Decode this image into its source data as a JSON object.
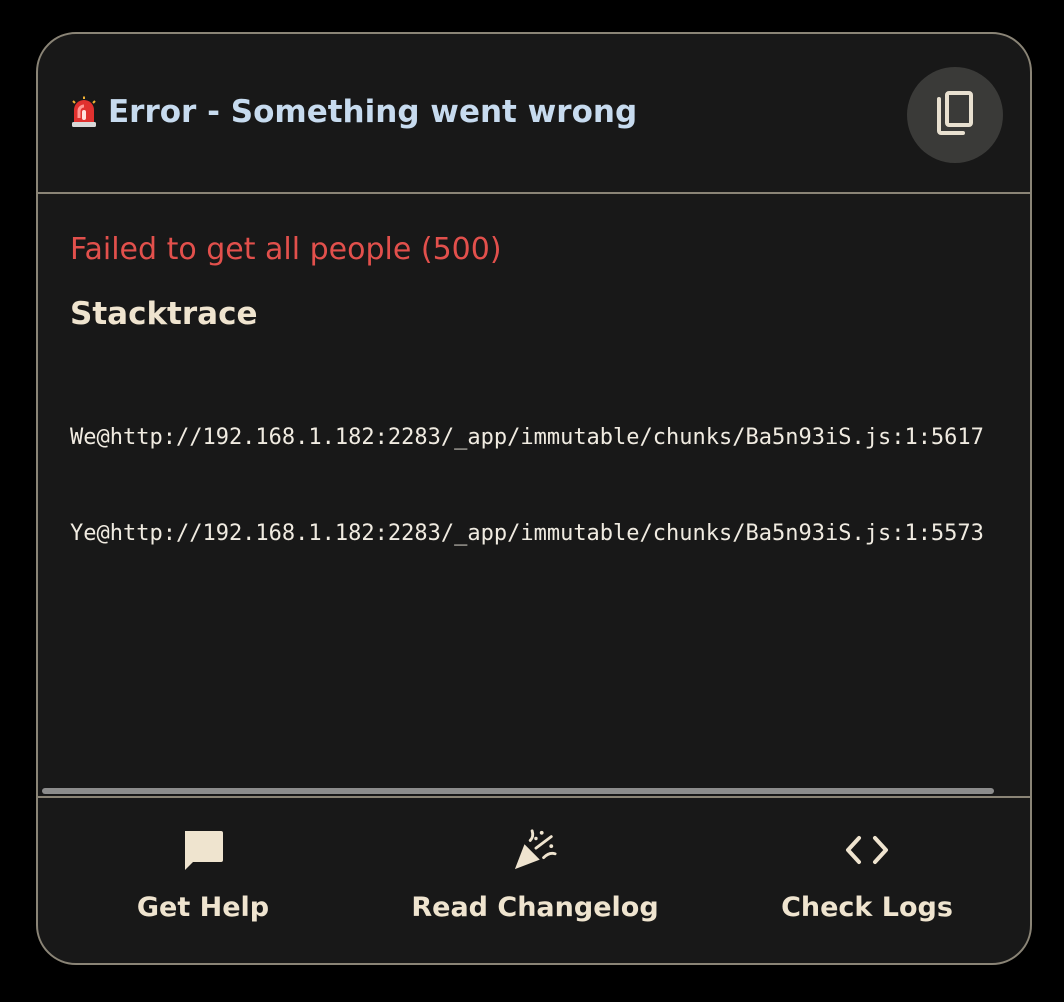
{
  "header": {
    "title": "Error - Something went wrong",
    "siren_icon": "siren-icon",
    "copy_icon": "copy-icon"
  },
  "error": {
    "message": "Failed to get all people (500)",
    "stack_heading": "Stacktrace",
    "stack_lines": [
      "We@http://192.168.1.182:2283/_app/immutable/chunks/Ba5n93iS.js:1:5617",
      "Ye@http://192.168.1.182:2283/_app/immutable/chunks/Ba5n93iS.js:1:5573"
    ]
  },
  "footer": {
    "buttons": [
      {
        "label": "Get Help",
        "icon": "chat-bubble-icon"
      },
      {
        "label": "Read Changelog",
        "icon": "party-popper-icon"
      },
      {
        "label": "Check Logs",
        "icon": "code-brackets-icon"
      }
    ]
  },
  "colors": {
    "background": "#000000",
    "card": "#181818",
    "border": "#8a8476",
    "title": "#c7dbef",
    "error": "#e2504c",
    "text": "#efe4cf",
    "copy_button_bg": "#3a3a38"
  }
}
